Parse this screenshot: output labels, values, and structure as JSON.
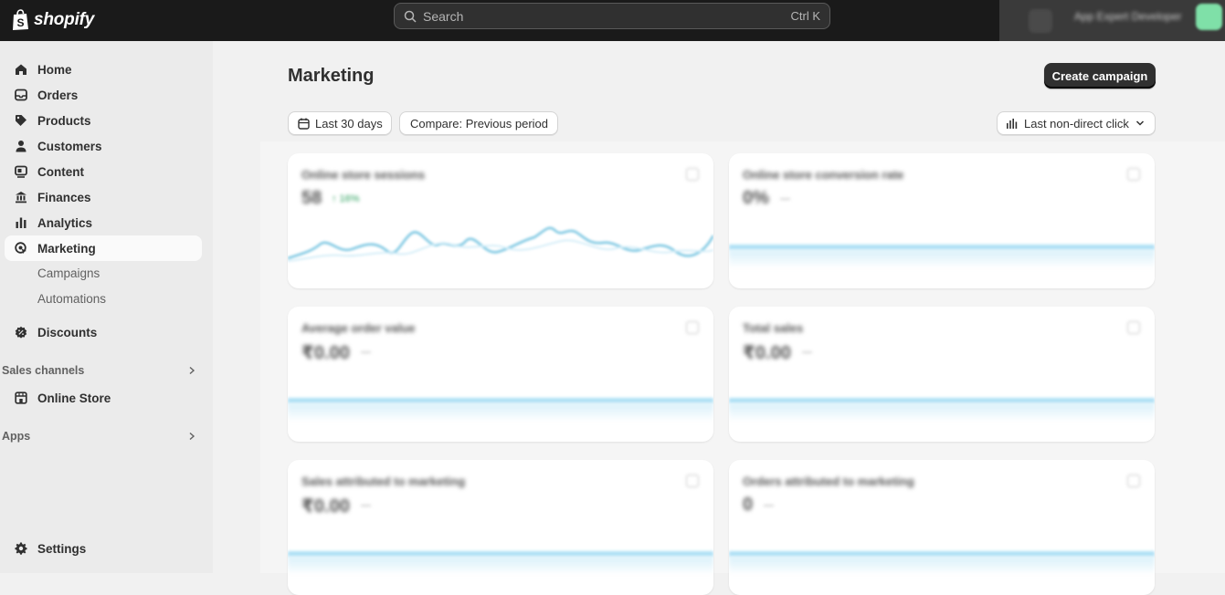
{
  "topbar": {
    "logo_text": "shopify",
    "search_placeholder": "Search",
    "search_shortcut": "Ctrl K",
    "store_name": "App Expert Developer",
    "avatar_color": "#7fe0a8"
  },
  "sidebar": {
    "items": [
      {
        "label": "Home",
        "icon": "home-icon"
      },
      {
        "label": "Orders",
        "icon": "orders-icon"
      },
      {
        "label": "Products",
        "icon": "tag-icon"
      },
      {
        "label": "Customers",
        "icon": "person-icon"
      },
      {
        "label": "Content",
        "icon": "content-icon"
      },
      {
        "label": "Finances",
        "icon": "bank-icon"
      },
      {
        "label": "Analytics",
        "icon": "bar-chart-icon"
      },
      {
        "label": "Marketing",
        "icon": "target-icon",
        "active": true
      }
    ],
    "marketing_sub": [
      "Campaigns",
      "Automations"
    ],
    "discounts_label": "Discounts",
    "sales_channels_label": "Sales channels",
    "online_store_label": "Online Store",
    "apps_label": "Apps",
    "settings_label": "Settings"
  },
  "main": {
    "title": "Marketing",
    "create_button": "Create campaign",
    "date_filter": "Last 30 days",
    "compare_filter": "Compare: Previous period",
    "attribution": "Last non-direct click"
  },
  "cards": [
    {
      "title": "Online store sessions",
      "value": "58",
      "delta": "↑ 16%"
    },
    {
      "title": "Online store conversion rate",
      "value": "0%",
      "delta": "—"
    },
    {
      "title": "Average order value",
      "value": "₹0.00",
      "delta": "—"
    },
    {
      "title": "Total sales",
      "value": "₹0.00",
      "delta": "—"
    },
    {
      "title": "Sales attributed to marketing",
      "value": "₹0.00",
      "delta": "—"
    },
    {
      "title": "Orders attributed to marketing",
      "value": "0",
      "delta": "—"
    }
  ],
  "colors": {
    "topbar": "#1a1a1a",
    "accent_line": "#aee0f5",
    "sparkline": "#8fcfe6",
    "positive": "#2aa05c"
  }
}
